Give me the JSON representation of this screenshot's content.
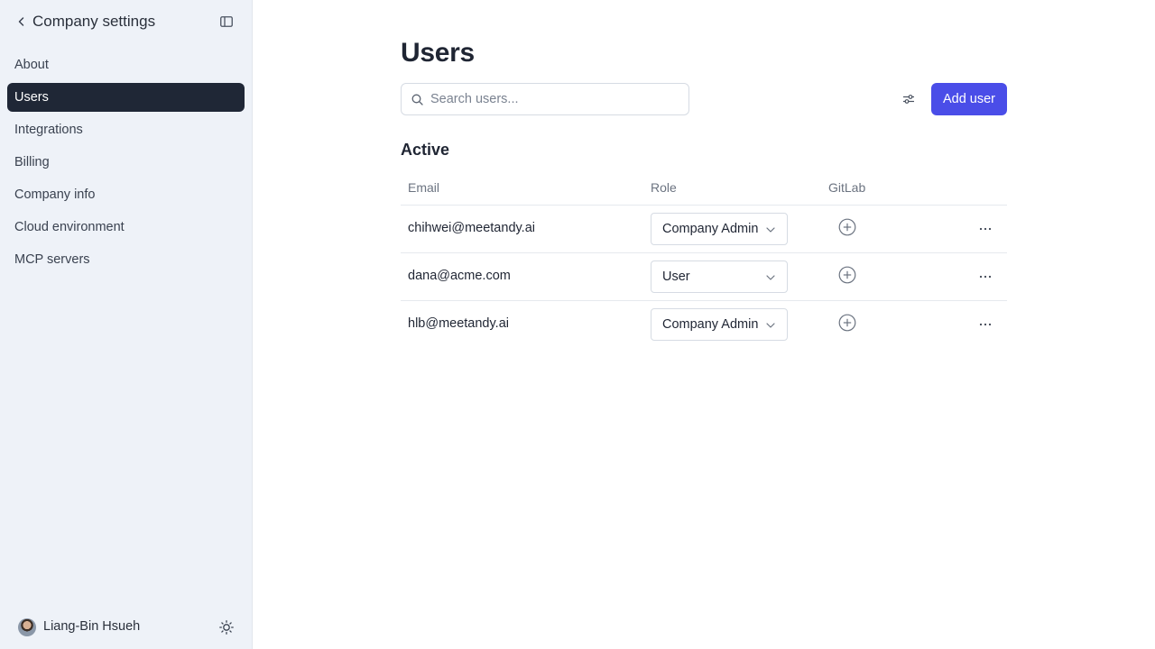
{
  "sidebar": {
    "title": "Company settings",
    "back_icon": "chevron-left-icon",
    "collapse_icon": "sidebar-toggle-icon",
    "items": [
      {
        "label": "About",
        "active": false
      },
      {
        "label": "Users",
        "active": true
      },
      {
        "label": "Integrations",
        "active": false
      },
      {
        "label": "Billing",
        "active": false
      },
      {
        "label": "Company info",
        "active": false
      },
      {
        "label": "Cloud environment",
        "active": false
      },
      {
        "label": "MCP servers",
        "active": false
      }
    ],
    "user": {
      "name": "Liang-Bin Hsueh"
    },
    "theme_icon": "sun-icon"
  },
  "main": {
    "title": "Users",
    "search": {
      "placeholder": "Search users...",
      "value": ""
    },
    "add_button": "Add user",
    "section": "Active",
    "columns": {
      "email": "Email",
      "role": "Role",
      "gitlab": "GitLab"
    },
    "rows": [
      {
        "email": "chihwei@meetandy.ai",
        "role": "Company Admin"
      },
      {
        "email": "dana@acme.com",
        "role": "User"
      },
      {
        "email": "hlb@meetandy.ai",
        "role": "Company Admin"
      }
    ]
  },
  "colors": {
    "accent": "#4a4de8",
    "sidebar_bg": "#eef2f8",
    "active_item": "#1f2736"
  }
}
